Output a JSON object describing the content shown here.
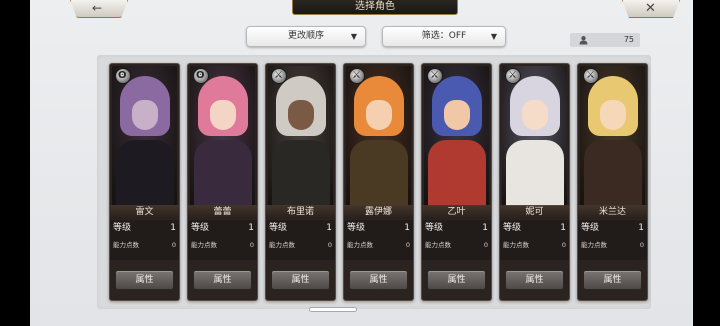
{
  "header": {
    "title": "选择角色",
    "back_icon": "←",
    "close_icon": "✕"
  },
  "controls": {
    "sort_label": "更改顺序",
    "filter_label": "筛选：OFF",
    "caret": "▼",
    "character_count": "75"
  },
  "stat_labels": {
    "level": "等级",
    "skill_points": "能力点数",
    "attribute_button": "属性"
  },
  "characters": [
    {
      "name": "雷文",
      "level": "1",
      "points": "0",
      "element": "wind",
      "element_glyph": "ʘ",
      "palette": {
        "bg": "#3a2f3a",
        "hair": "#8a6aa0",
        "face": "#c8b0c8",
        "body": "#1e1a22"
      }
    },
    {
      "name": "蕾蕾",
      "level": "1",
      "points": "0",
      "element": "wind",
      "element_glyph": "ʘ",
      "palette": {
        "bg": "#4a3848",
        "hair": "#e07a9a",
        "face": "#f4d4c4",
        "body": "#3a2a3e"
      }
    },
    {
      "name": "布里诺",
      "level": "1",
      "points": "0",
      "element": "sword",
      "element_glyph": "⚔",
      "palette": {
        "bg": "#4a4540",
        "hair": "#cfcac4",
        "face": "#7a5a44",
        "body": "#2a2824"
      }
    },
    {
      "name": "露伊娜",
      "level": "1",
      "points": "0",
      "element": "sword",
      "element_glyph": "⚔",
      "palette": {
        "bg": "#4a3024",
        "hair": "#e88a3a",
        "face": "#f4d0b0",
        "body": "#4a3a24"
      }
    },
    {
      "name": "乙叶",
      "level": "1",
      "points": "0",
      "element": "sword",
      "element_glyph": "⚔",
      "palette": {
        "bg": "#3a3444",
        "hair": "#4a5ab0",
        "face": "#f0c8a8",
        "body": "#b03a30"
      }
    },
    {
      "name": "妮可",
      "level": "1",
      "points": "0",
      "element": "sword",
      "element_glyph": "⚔",
      "palette": {
        "bg": "#5a5868",
        "hair": "#d8d4e0",
        "face": "#f4dcc8",
        "body": "#e8e4e0"
      }
    },
    {
      "name": "米兰达",
      "level": "1",
      "points": "0",
      "element": "sword",
      "element_glyph": "⚔",
      "palette": {
        "bg": "#4a3a2a",
        "hair": "#e8c870",
        "face": "#f4d8b8",
        "body": "#3a2a22"
      }
    }
  ]
}
